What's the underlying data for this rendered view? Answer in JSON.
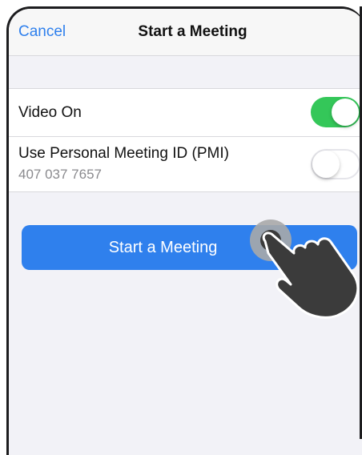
{
  "nav": {
    "cancel_label": "Cancel",
    "title": "Start a Meeting"
  },
  "settings": {
    "video_on": {
      "label": "Video On",
      "enabled": true
    },
    "pmi": {
      "label": "Use Personal Meeting ID (PMI)",
      "value": "407 037 7657",
      "enabled": false
    }
  },
  "start_button": {
    "label": "Start a Meeting"
  },
  "colors": {
    "accent": "#2f80ed",
    "toggle_on": "#34c759",
    "background": "#f2f2f7"
  },
  "overlay": {
    "icon": "tap-hand-icon"
  }
}
